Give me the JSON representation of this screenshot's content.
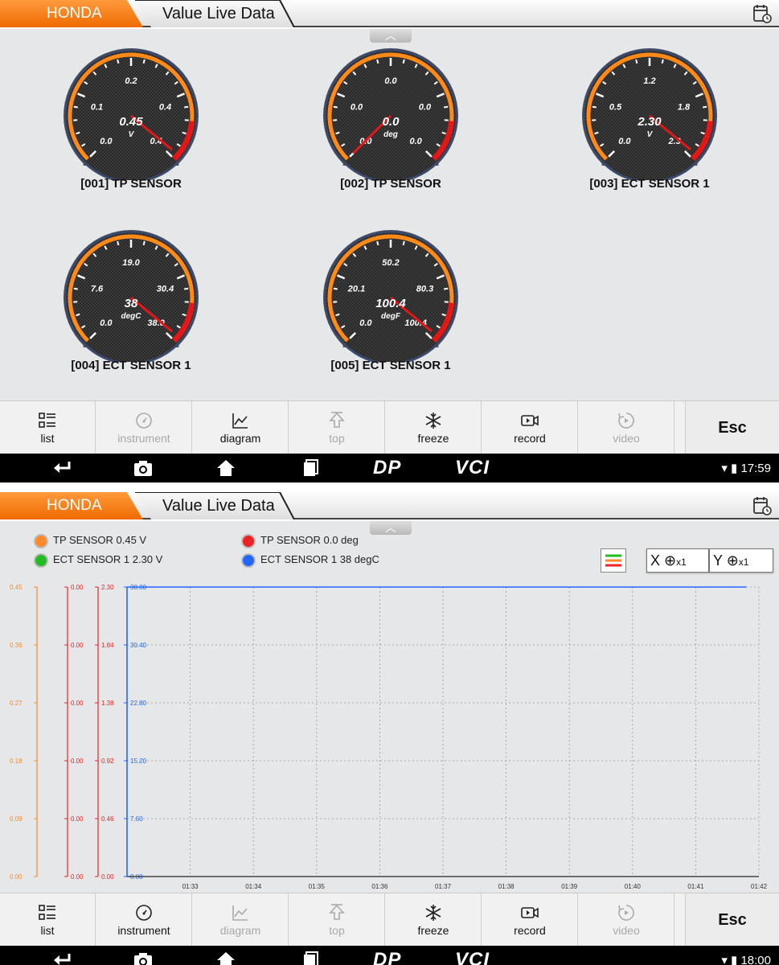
{
  "screen1": {
    "brand": "HONDA",
    "title": "Value Live Data",
    "gauges": [
      {
        "label": "[001] TP SENSOR",
        "value": "0.45",
        "unit": "V",
        "ticks": [
          "0.0",
          "0.1",
          "0.2",
          "0.4",
          "0.4"
        ],
        "fraction": 0.98
      },
      {
        "label": "[002] TP SENSOR",
        "value": "0.0",
        "unit": "deg",
        "ticks": [
          "0.0",
          "0.0",
          "0.0",
          "0.0",
          "0.0"
        ],
        "fraction": 0.0
      },
      {
        "label": "[003] ECT SENSOR 1",
        "value": "2.30",
        "unit": "V",
        "ticks": [
          "0.0",
          "0.5",
          "1.2",
          "1.8",
          "2.3"
        ],
        "fraction": 0.98
      },
      {
        "label": "[004] ECT SENSOR 1",
        "value": "38",
        "unit": "degC",
        "ticks": [
          "0.0",
          "7.6",
          "19.0",
          "30.4",
          "38.0"
        ],
        "fraction": 0.98
      },
      {
        "label": "[005] ECT SENSOR 1",
        "value": "100.4",
        "unit": "degF",
        "ticks": [
          "0.0",
          "20.1",
          "50.2",
          "80.3",
          "100.4"
        ],
        "fraction": 0.98
      }
    ],
    "toolbar": {
      "list": "list",
      "instrument": "instrument",
      "diagram": "diagram",
      "top": "top",
      "freeze": "freeze",
      "record": "record",
      "video": "video",
      "esc": "Esc"
    },
    "navbar": {
      "brand1": "DP",
      "brand2": "VCI",
      "clock": "17:59"
    }
  },
  "screen2": {
    "brand": "HONDA",
    "title": "Value Live Data",
    "legend": [
      {
        "label": "TP SENSOR  0.45 V",
        "color": "#ff8a2a"
      },
      {
        "label": "TP SENSOR  0.0 deg",
        "color": "#ee2222"
      },
      {
        "label": "ECT SENSOR 1  2.30 V",
        "color": "#22bb22"
      },
      {
        "label": "ECT SENSOR 1  38 degC",
        "color": "#2266ff"
      }
    ],
    "zoom": {
      "x_label": "X",
      "x_factor": "x1",
      "y_label": "Y",
      "y_factor": "x1"
    },
    "toolbar": {
      "list": "list",
      "instrument": "instrument",
      "diagram": "diagram",
      "top": "top",
      "freeze": "freeze",
      "record": "record",
      "video": "video",
      "esc": "Esc"
    },
    "navbar": {
      "brand1": "DP",
      "brand2": "VCI",
      "clock": "18:00"
    }
  },
  "chart_data": {
    "type": "line",
    "x": [
      "01:33",
      "01:34",
      "01:35",
      "01:36",
      "01:37",
      "01:38",
      "01:39",
      "01:40",
      "01:41",
      "01:42"
    ],
    "axes": [
      {
        "color": "#ff8a2a",
        "ticks": [
          "0.00",
          "0.09",
          "0.18",
          "0.27",
          "0.36",
          "0.45"
        ]
      },
      {
        "color": "#ee2222",
        "ticks": [
          "0.00",
          "0.00",
          "0.00",
          "0.00",
          "0.00",
          "0.00"
        ]
      },
      {
        "color": "#ee2222",
        "ticks": [
          "0.00",
          "0.46",
          "0.92",
          "1.38",
          "1.84",
          "2.30"
        ]
      },
      {
        "color": "#2266ff",
        "ticks": [
          "0.00",
          "7.60",
          "15.20",
          "22.80",
          "30.40",
          "38.00"
        ]
      }
    ],
    "series": [
      {
        "color": "#2266ff",
        "ymax": 38.0,
        "values": [
          38,
          38,
          38,
          38,
          38,
          38,
          38,
          38,
          38,
          38
        ]
      }
    ],
    "grid": true
  }
}
